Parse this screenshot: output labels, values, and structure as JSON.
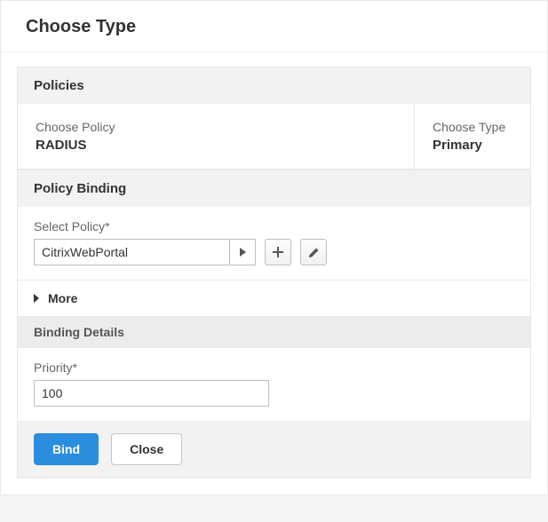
{
  "page_title": "Choose Type",
  "policies_panel": {
    "header": "Policies",
    "choose_policy_label": "Choose Policy",
    "choose_policy_value": "RADIUS",
    "choose_type_label": "Choose Type",
    "choose_type_value": "Primary"
  },
  "policy_binding": {
    "header": "Policy Binding",
    "select_policy_label": "Select Policy*",
    "select_policy_value": "CitrixWebPortal",
    "more_label": "More",
    "binding_details_header": "Binding Details",
    "priority_label": "Priority*",
    "priority_value": "100"
  },
  "buttons": {
    "bind": "Bind",
    "close": "Close"
  }
}
